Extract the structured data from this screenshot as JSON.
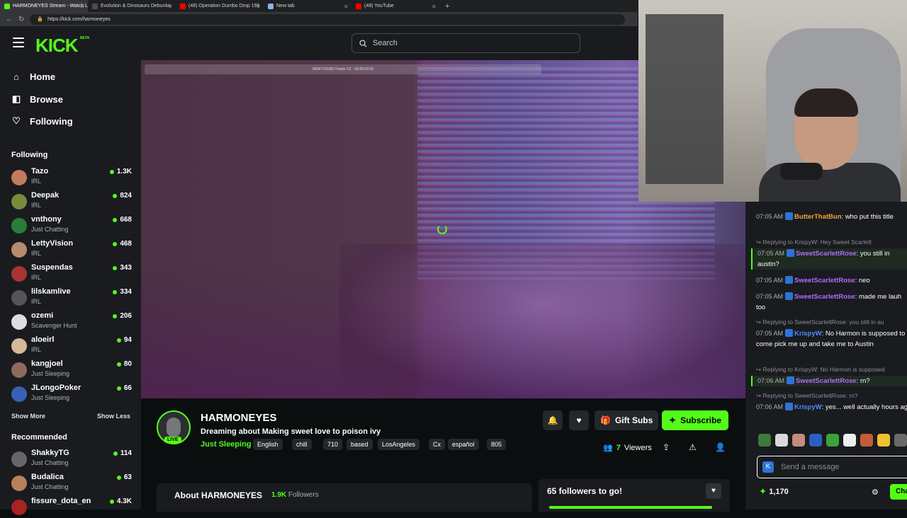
{
  "browser": {
    "tabs": [
      {
        "title": "HARMONEYES Stream - Watch Li",
        "fav": "#53fc18",
        "active": true
      },
      {
        "title": "Evolution & Dinosaurs Debunke",
        "fav": "#4e4e4e",
        "active": false
      },
      {
        "title": "(48) Operation Dumbo Drop 199",
        "fav": "#ff0000",
        "active": false
      },
      {
        "title": "New tab",
        "fav": "#8ab4f8",
        "active": false
      },
      {
        "title": "(48) YouTube",
        "fav": "#ff0000",
        "active": false
      }
    ],
    "new_tab": "+",
    "url": "https://kick.com/harmoneyes"
  },
  "header": {
    "logo": "KICK",
    "logo_beta": "BETA",
    "search_placeholder": "Search"
  },
  "sidebar": {
    "nav": [
      {
        "label": "Home",
        "icon": "home-icon",
        "glyph": "⌂"
      },
      {
        "label": "Browse",
        "icon": "browse-icon",
        "glyph": "◧"
      },
      {
        "label": "Following",
        "icon": "heart-icon",
        "glyph": "♡"
      }
    ],
    "following_title": "Following",
    "following": [
      {
        "name": "Tazo",
        "category": "IRL",
        "viewers": "1.3K",
        "color": "#c47b5a"
      },
      {
        "name": "Deepak",
        "category": "IRL",
        "viewers": "824",
        "color": "#7a8a3a"
      },
      {
        "name": "vnthony",
        "category": "Just Chatting",
        "viewers": "668",
        "color": "#2b7d3a"
      },
      {
        "name": "LettyVision",
        "category": "IRL",
        "viewers": "468",
        "color": "#b78c6e"
      },
      {
        "name": "Suspendas",
        "category": "IRL",
        "viewers": "343",
        "color": "#a33"
      },
      {
        "name": "lilskamlive",
        "category": "IRL",
        "viewers": "334",
        "color": "#555"
      },
      {
        "name": "ozemi",
        "category": "Scavenger Hunt",
        "viewers": "206",
        "color": "#ddd"
      },
      {
        "name": "aloeirl",
        "category": "IRL",
        "viewers": "94",
        "color": "#d3b89a"
      },
      {
        "name": "kangjoel",
        "category": "Just Sleeping",
        "viewers": "80",
        "color": "#8d6b5c"
      },
      {
        "name": "JLongoPoker",
        "category": "Just Sleeping",
        "viewers": "66",
        "color": "#3b5fb5"
      }
    ],
    "show_more": "Show More",
    "show_less": "Show Less",
    "recommended_title": "Recommended",
    "recommended": [
      {
        "name": "ShakkyTG",
        "category": "Just Chatting",
        "viewers": "114",
        "color": "#666"
      },
      {
        "name": "Budalica",
        "category": "Just Chatting",
        "viewers": "63",
        "color": "#b5835a"
      },
      {
        "name": "fissure_dota_en",
        "category": "",
        "viewers": "4.3K",
        "color": "#a22"
      }
    ]
  },
  "video": {
    "top_strip": "NEW FOUND Frame 1/1 - 00:00:00.00"
  },
  "stream": {
    "live": "LIVE",
    "streamer": "HARMONEYES",
    "title": "Dreaming about Making sweet love to poison ivy",
    "category": "Just Sleeping",
    "tags": [
      "English",
      "chill",
      "710",
      "based",
      "LosAngeles",
      "Cx",
      "español",
      "805"
    ],
    "gift_subs": "Gift Subs",
    "subscribe": "Subscribe",
    "viewers_count": "7",
    "viewers_label": "Viewers",
    "about_title": "About HARMONEYES",
    "followers_count": "1.9K",
    "followers_label": "Followers",
    "goal_text": "65 followers to go!",
    "goal_progress": 0.96
  },
  "chat": {
    "messages": [
      {
        "type": "msg",
        "time": "07:05 AM",
        "user": "ButterThatBun",
        "color": "#f0a53b",
        "text": "who put this title",
        "highlight": false
      },
      {
        "type": "reply",
        "text": "Replying to KrispyW: Hey Sweet Scarlett"
      },
      {
        "type": "msg",
        "time": "07:05 AM",
        "user": "SweetScarlettRose",
        "color": "#b36bff",
        "text": "you still in austin?",
        "highlight": true
      },
      {
        "type": "msg",
        "time": "07:05 AM",
        "user": "SweetScarlettRose",
        "color": "#b36bff",
        "text": "neo",
        "highlight": false
      },
      {
        "type": "msg",
        "time": "07:05 AM",
        "user": "SweetScarlettRose",
        "color": "#b36bff",
        "text": "made me lauh too",
        "highlight": false
      },
      {
        "type": "reply",
        "text": "Replying to SweetScarlettRose: you still in au"
      },
      {
        "type": "msg",
        "time": "07:05 AM",
        "user": "KrispyW",
        "color": "#4f8cff",
        "text": "No Harmon is supposed to come pick me up and take me to Austin",
        "highlight": false
      },
      {
        "type": "reply",
        "text": "Replying to KrispyW: No Harmon is supposed"
      },
      {
        "type": "msg",
        "time": "07:06 AM",
        "user": "SweetScarlettRose",
        "color": "#b36bff",
        "text": "rn?",
        "highlight": true
      },
      {
        "type": "reply",
        "text": "Replying to SweetScarlettRose: rn?"
      },
      {
        "type": "msg",
        "time": "07:06 AM",
        "user": "KrispyW",
        "color": "#4f8cff",
        "text": "yes... well actually hours ago",
        "highlight": false
      }
    ],
    "emotes": [
      "#3c7a3c",
      "#d9d9d9",
      "#c58b7c",
      "#2a5fc2",
      "#3aa33a",
      "#eeeeee",
      "#c45d3a",
      "#f0c030",
      "#6a6a6a"
    ],
    "input_placeholder": "Send a message",
    "points": "1,170",
    "send_label": "Chat"
  }
}
